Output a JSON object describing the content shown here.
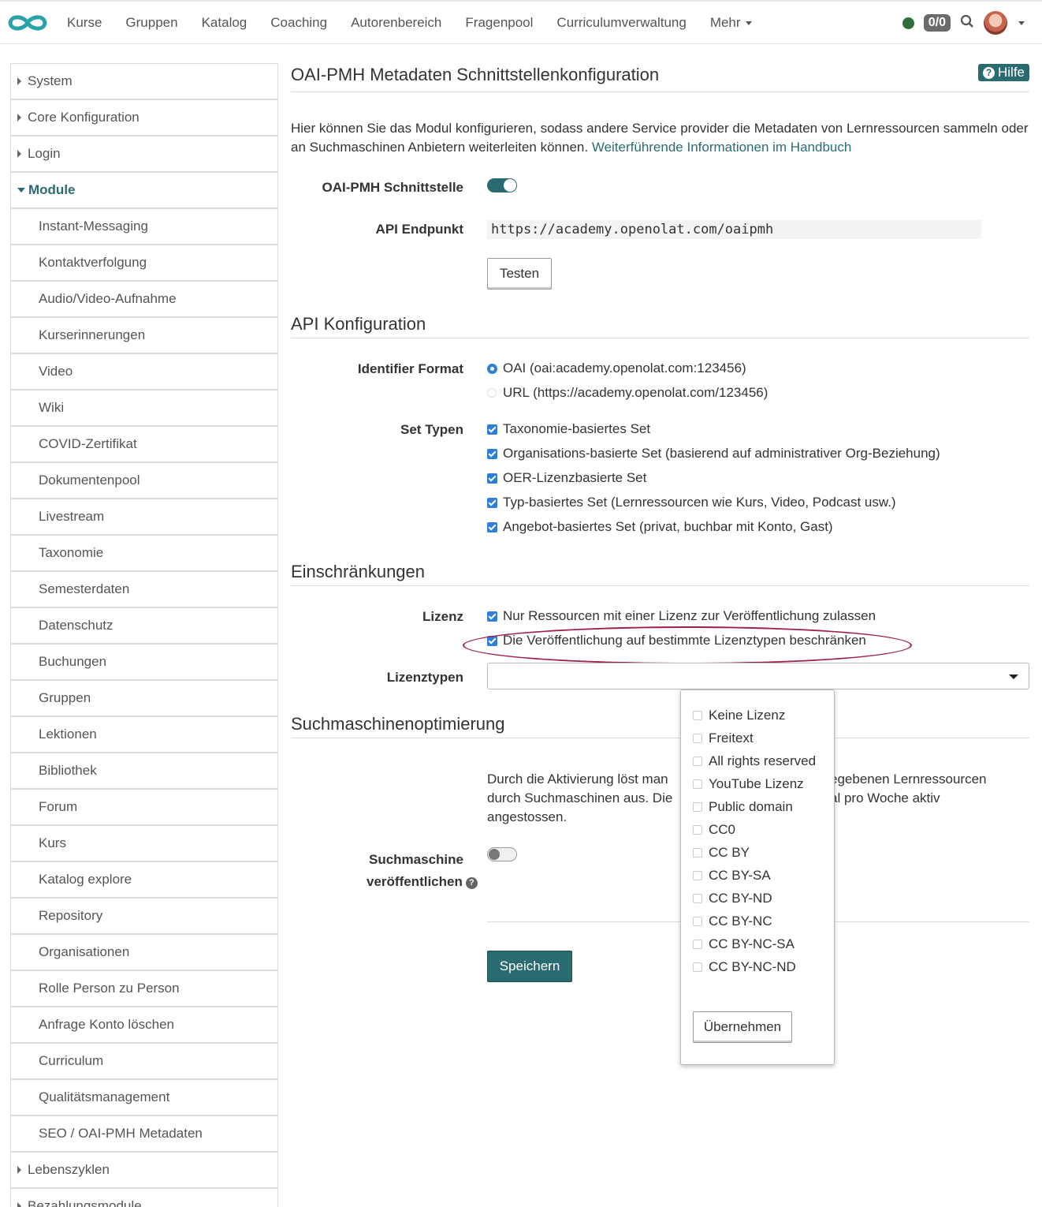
{
  "nav": {
    "items": [
      "Kurse",
      "Gruppen",
      "Katalog",
      "Coaching",
      "Autorenbereich",
      "Fragenpool",
      "Curriculumverwaltung",
      "Mehr"
    ],
    "badge": "0/0"
  },
  "sidebar": {
    "top_before": [
      "System",
      "Core Konfiguration",
      "Login"
    ],
    "active": "Module",
    "subs": [
      "Instant-Messaging",
      "Kontaktverfolgung",
      "Audio/Video-Aufnahme",
      "Kurserinnerungen",
      "Video",
      "Wiki",
      "COVID-Zertifikat",
      "Dokumentenpool",
      "Livestream",
      "Taxonomie",
      "Semesterdaten",
      "Datenschutz",
      "Buchungen",
      "Gruppen",
      "Lektionen",
      "Bibliothek",
      "Forum",
      "Kurs",
      "Katalog explore",
      "Repository",
      "Organisationen",
      "Rolle Person zu Person",
      "Anfrage Konto löschen",
      "Curriculum",
      "Qualitätsmanagement",
      "SEO / OAI-PMH Metadaten"
    ],
    "top_after": [
      "Lebenszyklen",
      "Bezahlungsmodule"
    ]
  },
  "main": {
    "title": "OAI-PMH Metadaten Schnittstellenkonfiguration",
    "help": "Hilfe",
    "intro_text": "Hier können Sie das Modul konfigurieren, sodass andere Service provider die Metadaten von Lernressourcen sammeln oder an Suchmaschinen Anbietern weiterleiten können.",
    "intro_link": "Weiterführende Informationen im Handbuch",
    "interface_label": "OAI-PMH Schnittstelle",
    "endpoint_label": "API Endpunkt",
    "endpoint_value": "https://academy.openolat.com/oaipmh",
    "test_button": "Testen",
    "api_section": "API Konfiguration",
    "identifier_label": "Identifier Format",
    "identifier_options": [
      "OAI (oai:academy.openolat.com:123456)",
      "URL (https://academy.openolat.com/123456)"
    ],
    "identifier_selected": 0,
    "set_label": "Set Typen",
    "set_options": [
      "Taxonomie-basiertes Set",
      "Organisations-basierte Set (basierend auf administrativer Org-Beziehung)",
      "OER-Lizenzbasierte Set",
      "Typ-basiertes Set (Lernressourcen wie Kurs, Video, Podcast usw.)",
      "Angebot-basiertes Set (privat, buchbar mit Konto, Gast)"
    ],
    "restrict_section": "Einschränkungen",
    "license_label": "Lizenz",
    "license_options": [
      "Nur Ressourcen mit einer Lizenz zur Veröffentlichung zulassen",
      "Die Veröffentlichung auf bestimmte Lizenztypen beschränken"
    ],
    "license_types_label": "Lizenztypen",
    "license_types": [
      "Keine Lizenz",
      "Freitext",
      "All rights reserved",
      "YouTube Lizenz",
      "Public domain",
      "CC0",
      "CC BY",
      "CC BY-SA",
      "CC BY-ND",
      "CC BY-NC",
      "CC BY-NC-SA",
      "CC BY-NC-ND"
    ],
    "apply_button": "Übernehmen",
    "seo_section": "Suchmaschinenoptimierung",
    "seo_text_line1_a": "Durch die Aktivierung löst man",
    "seo_text_line1_b": "egebenen Lernressourcen",
    "seo_text_line2_a": "durch Suchmaschinen aus. Die",
    "seo_text_line2_b": "al pro Woche aktiv",
    "seo_text_line3": "angestossen.",
    "search_label_1": "Suchmaschine",
    "search_label_2": "veröffentlichen",
    "save_button": "Speichern"
  },
  "colors": {
    "accent": "#2a6b72",
    "checkbox": "#2f7fd8",
    "highlight": "#9c2048",
    "status": "#2f6e3b"
  },
  "icons": [
    "openolat-logo-icon",
    "status-online-icon",
    "search-icon",
    "help-icon",
    "question-icon"
  ]
}
